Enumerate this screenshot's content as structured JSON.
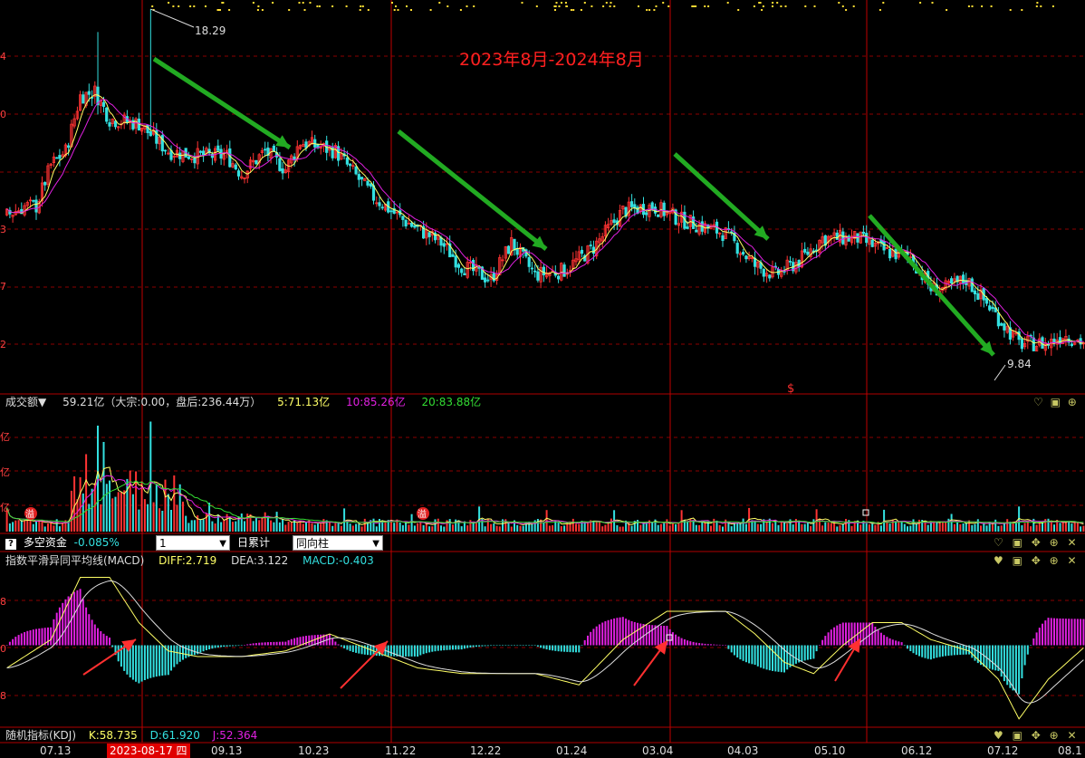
{
  "colors": {
    "up": "#ff3333",
    "down": "#33e0e0",
    "grid": "#8b0000",
    "ma5": "#ffff66",
    "ma10": "#e020e0",
    "ma20": "#33dd33",
    "arrow_green": "#22aa22",
    "arrow_red": "#ff3030",
    "annotation": "#ff2020"
  },
  "price_panel": {
    "annotation": "2023年8月-2024年8月",
    "high_label": "18.29",
    "low_label": "9.84",
    "y_ticks": [
      "4",
      "0",
      "3",
      "7",
      "2"
    ],
    "marker": "$"
  },
  "volume_panel": {
    "title": "成交额▼",
    "value": "59.21亿",
    "detail_open": "（大宗:",
    "block_value": "0.00",
    "detail_mid": "，盘后:",
    "after_value": "236.44万",
    "detail_close": "）",
    "ma5": "5:71.13亿",
    "ma10": "10:85.26亿",
    "ma20": "20:83.88亿",
    "y_ticks": [
      "亿",
      "亿",
      "亿"
    ],
    "badge": "溢"
  },
  "capital_bar": {
    "help": "?",
    "label": "多空资金",
    "value": "-0.085%",
    "select1": "1",
    "cumulative": "日累计",
    "select2": "同向柱"
  },
  "macd_panel": {
    "title": "指数平滑异同平均线(MACD)",
    "diff": "DIFF:2.719",
    "dea": "DEA:3.122",
    "macd": "MACD:-0.403",
    "y_ticks": [
      "8",
      "0",
      "8"
    ]
  },
  "kdj_panel": {
    "title": "随机指标(KDJ)",
    "k": "K:58.735",
    "d": "D:61.920",
    "j": "J:52.364"
  },
  "x_axis": {
    "labels": [
      "07.13",
      "09.13",
      "10.23",
      "11.22",
      "12.22",
      "01.24",
      "03.04",
      "04.03",
      "05.10",
      "06.12",
      "07.12",
      "08.1"
    ],
    "highlight": "2023-08-17 四"
  },
  "chart_data": {
    "type": "candlestick",
    "price_anchors": [
      [
        0,
        11.2
      ],
      [
        6,
        11.4
      ],
      [
        10,
        11.4
      ],
      [
        15,
        12.3
      ],
      [
        20,
        12.6
      ],
      [
        25,
        13.8
      ],
      [
        30,
        13.9
      ],
      [
        35,
        13.3
      ],
      [
        45,
        13.2
      ],
      [
        55,
        12.6
      ],
      [
        65,
        12.5
      ],
      [
        75,
        12.5
      ],
      [
        80,
        12.1
      ],
      [
        88,
        12.6
      ],
      [
        95,
        12.2
      ],
      [
        100,
        12.8
      ],
      [
        112,
        12.6
      ],
      [
        125,
        11.6
      ],
      [
        135,
        11.1
      ],
      [
        148,
        10.6
      ],
      [
        155,
        10.1
      ],
      [
        165,
        9.8
      ],
      [
        172,
        10.6
      ],
      [
        180,
        9.9
      ],
      [
        190,
        10.0
      ],
      [
        200,
        10.5
      ],
      [
        210,
        11.3
      ],
      [
        220,
        11.4
      ],
      [
        230,
        11.1
      ],
      [
        245,
        10.8
      ],
      [
        255,
        10.1
      ],
      [
        262,
        9.9
      ],
      [
        270,
        10.2
      ],
      [
        278,
        10.7
      ],
      [
        290,
        10.7
      ],
      [
        300,
        10.4
      ],
      [
        308,
        10.3
      ],
      [
        315,
        9.6
      ],
      [
        320,
        9.6
      ],
      [
        327,
        9.8
      ],
      [
        335,
        9.2
      ],
      [
        345,
        8.4
      ],
      [
        355,
        8.4
      ],
      [
        360,
        8.6
      ],
      [
        368,
        8.4
      ]
    ],
    "price_range": [
      7.4,
      15.8
    ],
    "volume_bars": 368,
    "volume_ma_lines": [
      "ma5",
      "ma10",
      "ma20"
    ],
    "macd_diff_anchors": [
      [
        0,
        -4
      ],
      [
        15,
        1
      ],
      [
        25,
        12
      ],
      [
        35,
        12
      ],
      [
        45,
        4
      ],
      [
        55,
        -1
      ],
      [
        65,
        -2
      ],
      [
        80,
        -2
      ],
      [
        95,
        -1
      ],
      [
        110,
        2
      ],
      [
        125,
        -1
      ],
      [
        140,
        -4
      ],
      [
        155,
        -5
      ],
      [
        180,
        -5
      ],
      [
        195,
        -7
      ],
      [
        210,
        1
      ],
      [
        225,
        6
      ],
      [
        245,
        6
      ],
      [
        255,
        2
      ],
      [
        265,
        -3
      ],
      [
        275,
        -5
      ],
      [
        285,
        0
      ],
      [
        295,
        4
      ],
      [
        305,
        4
      ],
      [
        315,
        1
      ],
      [
        328,
        -1
      ],
      [
        338,
        -6
      ],
      [
        345,
        -13
      ],
      [
        355,
        -6
      ],
      [
        368,
        0
      ]
    ],
    "macd_range": [
      -14,
      14
    ],
    "macd_histogram": "diff_minus_dea",
    "event_markers_top": "yellow dots row",
    "vertical_markers": [
      "2023-08-17",
      "11.22",
      "03.04",
      "05.10"
    ]
  }
}
